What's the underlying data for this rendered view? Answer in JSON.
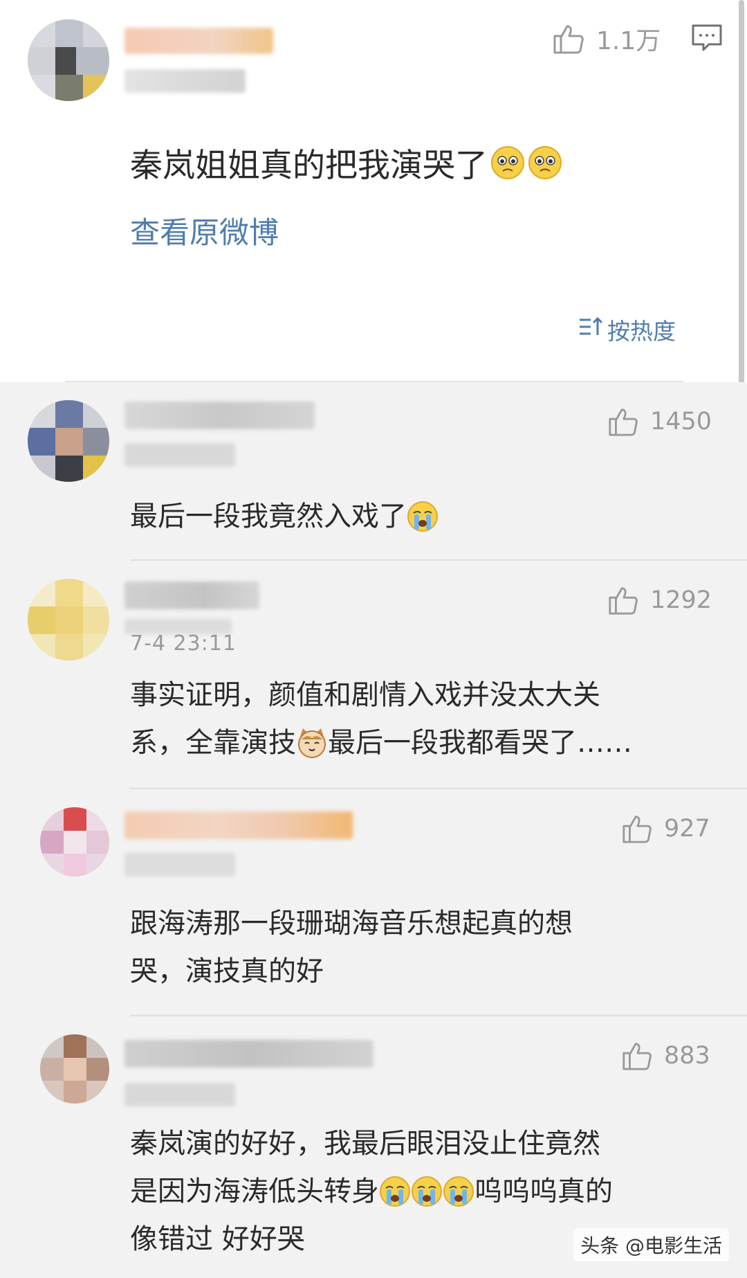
{
  "main_comment": {
    "likes": "1.1万",
    "text": "秦岚姐姐真的把我演哭了",
    "view_original": "查看原微博",
    "sort_label": "按热度"
  },
  "replies": [
    {
      "likes": "1450",
      "lines": [
        "最后一段我竟然入戏了"
      ],
      "emoji": "crying-emoji"
    },
    {
      "likes": "1292",
      "timestamp": "7-4 23:11",
      "lines": [
        "事实证明，颜值和剧情入戏并没太大关",
        "系，全靠演技",
        "最后一段我都看哭了……"
      ],
      "emoji": "cat-emoji"
    },
    {
      "likes": "927",
      "lines": [
        "跟海涛那一段珊瑚海音乐想起真的想",
        "哭，演技真的好"
      ]
    },
    {
      "likes": "883",
      "lines": [
        "秦岚演的好好，我最后眼泪没止住竟然",
        "是因为海涛低头转身",
        "呜呜呜真的",
        "像错过 好好哭"
      ],
      "emoji": "crying-emoji"
    }
  ],
  "watermark": "头条 @电影生活",
  "colors": {
    "link": "#507daf",
    "text": "#2a2a2a",
    "muted": "#9a9a9a",
    "reply_bg": "#f2f2f2"
  }
}
